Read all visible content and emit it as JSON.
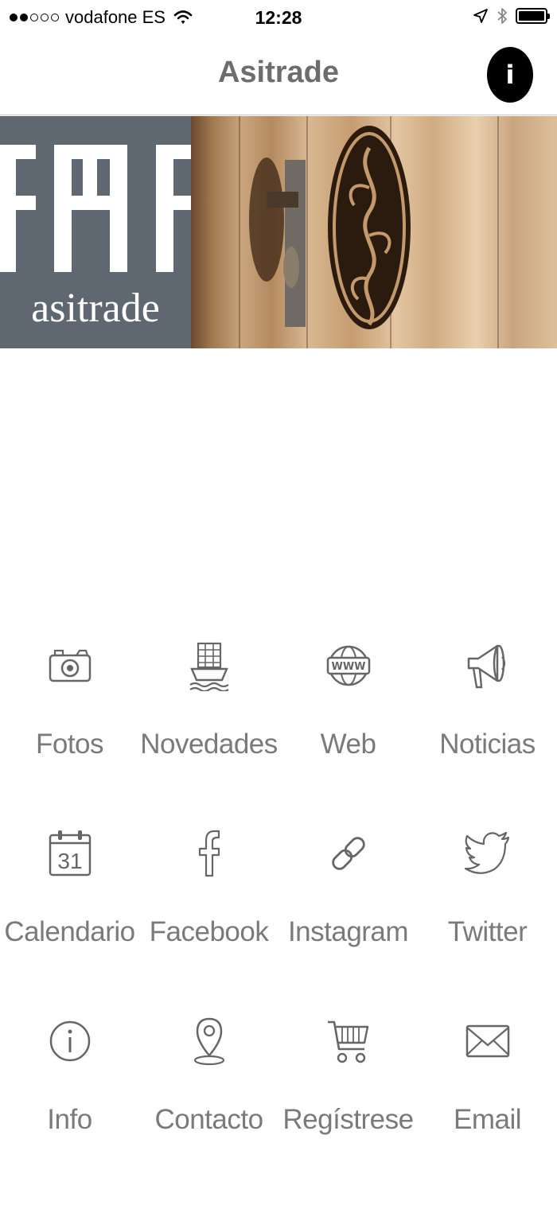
{
  "status_bar": {
    "carrier": "vodafone ES",
    "time": "12:28",
    "signal_bars_filled": 2,
    "signal_bars_total": 5,
    "battery_level": 1.0
  },
  "navbar": {
    "title": "Asitrade",
    "info_icon": "info-icon",
    "info_glyph": "i"
  },
  "banner": {
    "logo_text": "asitrade",
    "logo_mark": "AAF"
  },
  "menu": {
    "items": [
      {
        "label": "Fotos",
        "icon": "camera-icon"
      },
      {
        "label": "Novedades",
        "icon": "ship-icon"
      },
      {
        "label": "Web",
        "icon": "globe-www-icon"
      },
      {
        "label": "Noticias",
        "icon": "megaphone-icon"
      },
      {
        "label": "Calendario",
        "icon": "calendar-icon",
        "icon_text": "31"
      },
      {
        "label": "Facebook",
        "icon": "facebook-icon"
      },
      {
        "label": "Instagram",
        "icon": "link-icon"
      },
      {
        "label": "Twitter",
        "icon": "twitter-bird-icon"
      },
      {
        "label": "Info",
        "icon": "info-circle-icon"
      },
      {
        "label": "Contacto",
        "icon": "location-pin-icon"
      },
      {
        "label": "Regístrese",
        "icon": "shopping-cart-icon"
      },
      {
        "label": "Email",
        "icon": "envelope-icon"
      }
    ]
  },
  "colors": {
    "title": "#6d6d6d",
    "label": "#7a7a7a",
    "icon_stroke": "#666666",
    "logo_panel": "#5f6870"
  }
}
